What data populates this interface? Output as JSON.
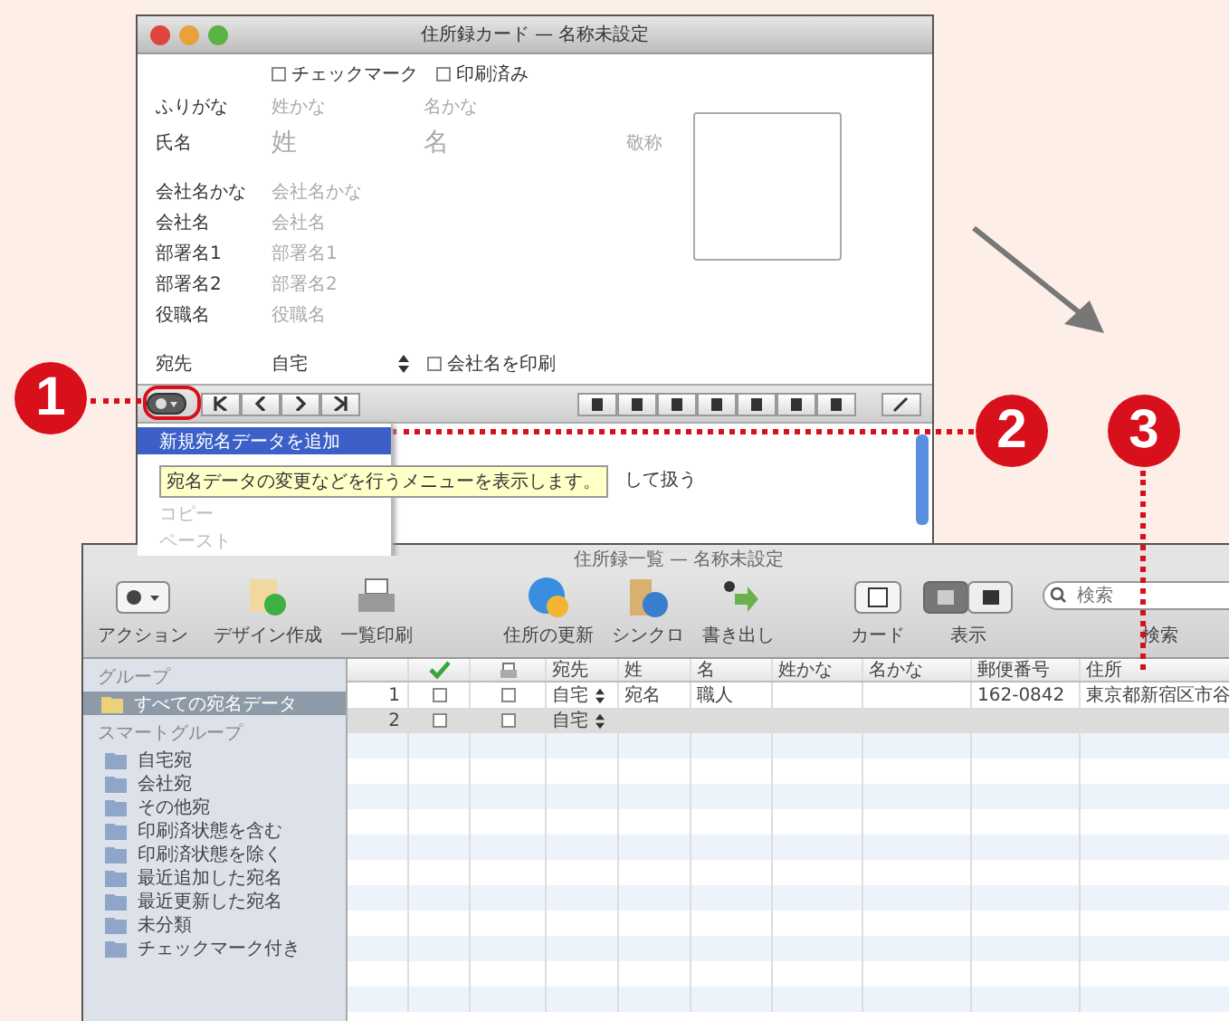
{
  "card_window": {
    "title": "住所録カード — 名称未設定",
    "flags": [
      {
        "label": "チェックマーク",
        "checked": false
      },
      {
        "label": "印刷済み",
        "checked": false
      }
    ],
    "fields": [
      {
        "label": "ふりがな",
        "placeholders": [
          "姓かな",
          "名かな"
        ]
      },
      {
        "label": "氏名",
        "placeholders": [
          "姓",
          "名",
          "敬称"
        ]
      },
      {
        "label": "会社名かな",
        "placeholders": [
          "会社名かな"
        ]
      },
      {
        "label": "会社名",
        "placeholders": [
          "会社名"
        ]
      },
      {
        "label": "部署名1",
        "placeholders": [
          "部署名1"
        ]
      },
      {
        "label": "部署名2",
        "placeholders": [
          "部署名2"
        ]
      },
      {
        "label": "役職名",
        "placeholders": [
          "役職名"
        ]
      }
    ],
    "destination": {
      "label": "宛先",
      "value": "自宅",
      "print_company": {
        "label": "会社名を印刷",
        "checked": false
      }
    },
    "action_menu": [
      {
        "label": "新規宛名データを追加",
        "selected": true,
        "disabled": false
      },
      {
        "label": "コピー",
        "selected": false,
        "disabled": true
      },
      {
        "label": "ペースト",
        "selected": false,
        "disabled": true
      }
    ],
    "tooltip": "宛名データの変更などを行うメニューを表示します。",
    "option_text": "して扱う"
  },
  "list_window": {
    "title": "住所録一覧 — 名称未設定",
    "toolbar": [
      {
        "label": "アクション",
        "kind": "action"
      },
      {
        "label": "デザイン作成",
        "kind": "design"
      },
      {
        "label": "一覧印刷",
        "kind": "print"
      },
      {
        "label": "住所の更新",
        "kind": "update"
      },
      {
        "label": "シンクロ",
        "kind": "sync"
      },
      {
        "label": "書き出し",
        "kind": "export"
      },
      {
        "label": "カード",
        "kind": "card"
      },
      {
        "label": "表示",
        "kind": "view"
      }
    ],
    "search": {
      "placeholder": "検索",
      "label": "検索"
    },
    "sidebar": {
      "heading": "グループ",
      "groups": [
        {
          "label": "すべての宛名データ",
          "selected": true
        }
      ],
      "smart_heading": "スマートグループ",
      "smart_groups": [
        {
          "label": "自宅宛",
          "selected": false
        },
        {
          "label": "会社宛",
          "selected": false
        },
        {
          "label": "その他宛",
          "selected": false
        },
        {
          "label": "印刷済状態を含む",
          "selected": false
        },
        {
          "label": "印刷済状態を除く",
          "selected": false
        },
        {
          "label": "最近追加した宛名",
          "selected": false
        },
        {
          "label": "最近更新した宛名",
          "selected": false
        },
        {
          "label": "未分類",
          "selected": false
        },
        {
          "label": "チェックマーク付き",
          "selected": false
        }
      ]
    },
    "table": {
      "columns": [
        "宛先",
        "姓",
        "名",
        "姓かな",
        "名かな",
        "郵便番号",
        "住所"
      ],
      "rows": [
        {
          "number": "1",
          "checked": false,
          "printed": false,
          "selected": false,
          "cells": [
            "自宅",
            "宛名",
            "職人",
            null,
            null,
            "162-0842",
            "東京都新宿区市谷"
          ]
        },
        {
          "number": "2",
          "checked": false,
          "printed": false,
          "selected": true,
          "cells": [
            "自宅",
            null,
            null,
            null,
            null,
            null,
            null
          ]
        }
      ]
    }
  },
  "callouts": [
    {
      "label": "1"
    },
    {
      "label": "2"
    },
    {
      "label": "3"
    }
  ]
}
